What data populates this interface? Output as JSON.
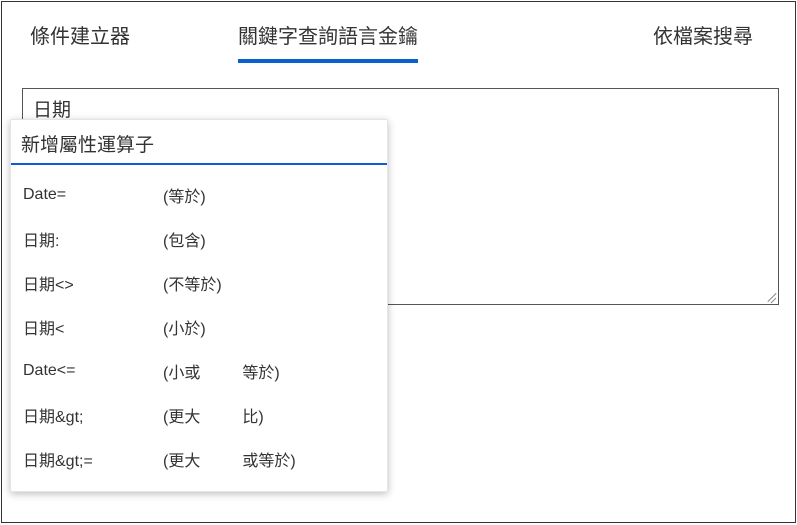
{
  "tabs": {
    "left": "條件建立器",
    "center": "關鍵字查詢語言金鑰",
    "right": "依檔案搜尋"
  },
  "search": {
    "value": "日期"
  },
  "dropdown": {
    "header": "新增屬性運算子",
    "items": [
      {
        "key": "Date=",
        "desc1": "(等於)",
        "desc2": ""
      },
      {
        "key": "日期:",
        "desc1": "(包含)",
        "desc2": ""
      },
      {
        "key": "日期<>",
        "desc1": "(不等於)",
        "desc2": ""
      },
      {
        "key": "日期<",
        "desc1": "(小於)",
        "desc2": ""
      },
      {
        "key": "Date<=",
        "desc1": "(小或",
        "desc2": "等於)"
      },
      {
        "key": "日期&gt;",
        "desc1": "(更大",
        "desc2": "比)"
      },
      {
        "key": "日期&gt;=",
        "desc1": "(更大",
        "desc2": "或等於)"
      }
    ]
  }
}
